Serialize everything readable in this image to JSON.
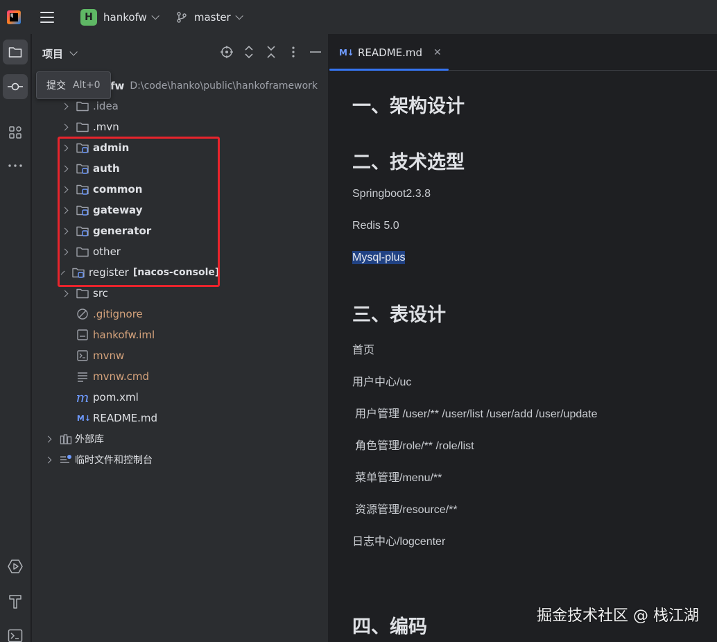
{
  "titlebar": {
    "project_badge": "H",
    "project_name": "hankofw",
    "branch_name": "master"
  },
  "tooltip": {
    "label": "提交",
    "shortcut": "Alt+0"
  },
  "panel": {
    "title": "项目",
    "root": {
      "name_visible": "fw",
      "path": "D:\\code\\hanko\\public\\hankoframework"
    },
    "items": [
      {
        "label": ".idea",
        "style": "dim"
      },
      {
        "label": ".mvn",
        "style": "normal"
      },
      {
        "label": "admin",
        "style": "bold"
      },
      {
        "label": "auth",
        "style": "bold"
      },
      {
        "label": "common",
        "style": "bold"
      },
      {
        "label": "gateway",
        "style": "bold"
      },
      {
        "label": "generator",
        "style": "bold"
      },
      {
        "label": "other",
        "style": "normal"
      },
      {
        "label": "register",
        "suffix": "[nacos-console]",
        "style": "normal"
      },
      {
        "label": "src",
        "style": "normal"
      },
      {
        "label": ".gitignore",
        "style": "orange"
      },
      {
        "label": "hankofw.iml",
        "style": "orange"
      },
      {
        "label": "mvnw",
        "style": "orange"
      },
      {
        "label": "mvnw.cmd",
        "style": "orange"
      },
      {
        "label": "pom.xml",
        "style": "normal"
      },
      {
        "label": "README.md",
        "style": "normal"
      },
      {
        "label": "外部库",
        "style": "normal"
      },
      {
        "label": "临时文件和控制台",
        "style": "normal"
      }
    ]
  },
  "editor": {
    "tab": {
      "icon": "M↓",
      "label": "README.md"
    },
    "content": {
      "h1": "一、架构设计",
      "h2": "二、技术选型",
      "p1": "Springboot2.3.8",
      "p2": "Redis 5.0",
      "p3": "Mysql-plus",
      "h3": "三、表设计",
      "p4": "首页",
      "p5": "用户中心/uc",
      "p6": "用户管理 /user/** /user/list /user/add /user/update",
      "p7": "角色管理/role/** /role/list",
      "p8": "菜单管理/menu/**",
      "p9": "资源管理/resource/**",
      "p10": "日志中心/logcenter",
      "h4": "四、编码"
    }
  },
  "watermark": "掘金技术社区 @ 栈江湖",
  "colors": {
    "accent": "#3574f0",
    "highlight_box": "#e8242c",
    "project_badge": "#5fb865",
    "ignored_file": "#d5a37c",
    "selection": "#214283"
  }
}
